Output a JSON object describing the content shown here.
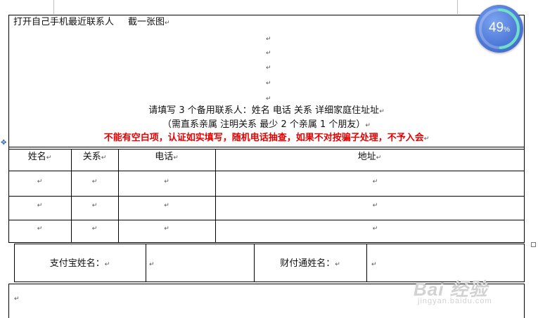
{
  "document": {
    "top_instruction": "打开自己手机最近联系人",
    "screenshot_note": "截一张图",
    "request_line": "请填写 3 个备用联系人：姓名  电话  关系  详细家庭住址址",
    "request_note": "（需直系亲属    注明关系  最少 2 个亲属 1 个朋友）",
    "warning": "不能有空白项，认证如实填写，随机电话抽查，如果不对按骗子处理，不予入会",
    "paragraph_mark": "↵"
  },
  "contacts_table": {
    "headers": [
      "姓名",
      "关系",
      "电话",
      "地址"
    ],
    "rows": [
      [
        "",
        "",
        "",
        ""
      ],
      [
        "",
        "",
        "",
        ""
      ],
      [
        "",
        "",
        "",
        ""
      ]
    ]
  },
  "payment_table": {
    "alipay_label": "支付宝姓名：",
    "alipay_value": "",
    "tenpay_label": "财付通姓名：",
    "tenpay_value": ""
  },
  "progress_badge": {
    "value": "49",
    "unit": "%",
    "percent": 49,
    "ring_color": "#6ee0c8",
    "bg_color": "#4e79d8"
  },
  "watermark": {
    "main": "Bai 经验",
    "sub": "jingyan.baidu.com"
  },
  "icons": {
    "move_handle": "table-move-handle-icon",
    "resize_handle": "table-resize-handle-icon"
  }
}
